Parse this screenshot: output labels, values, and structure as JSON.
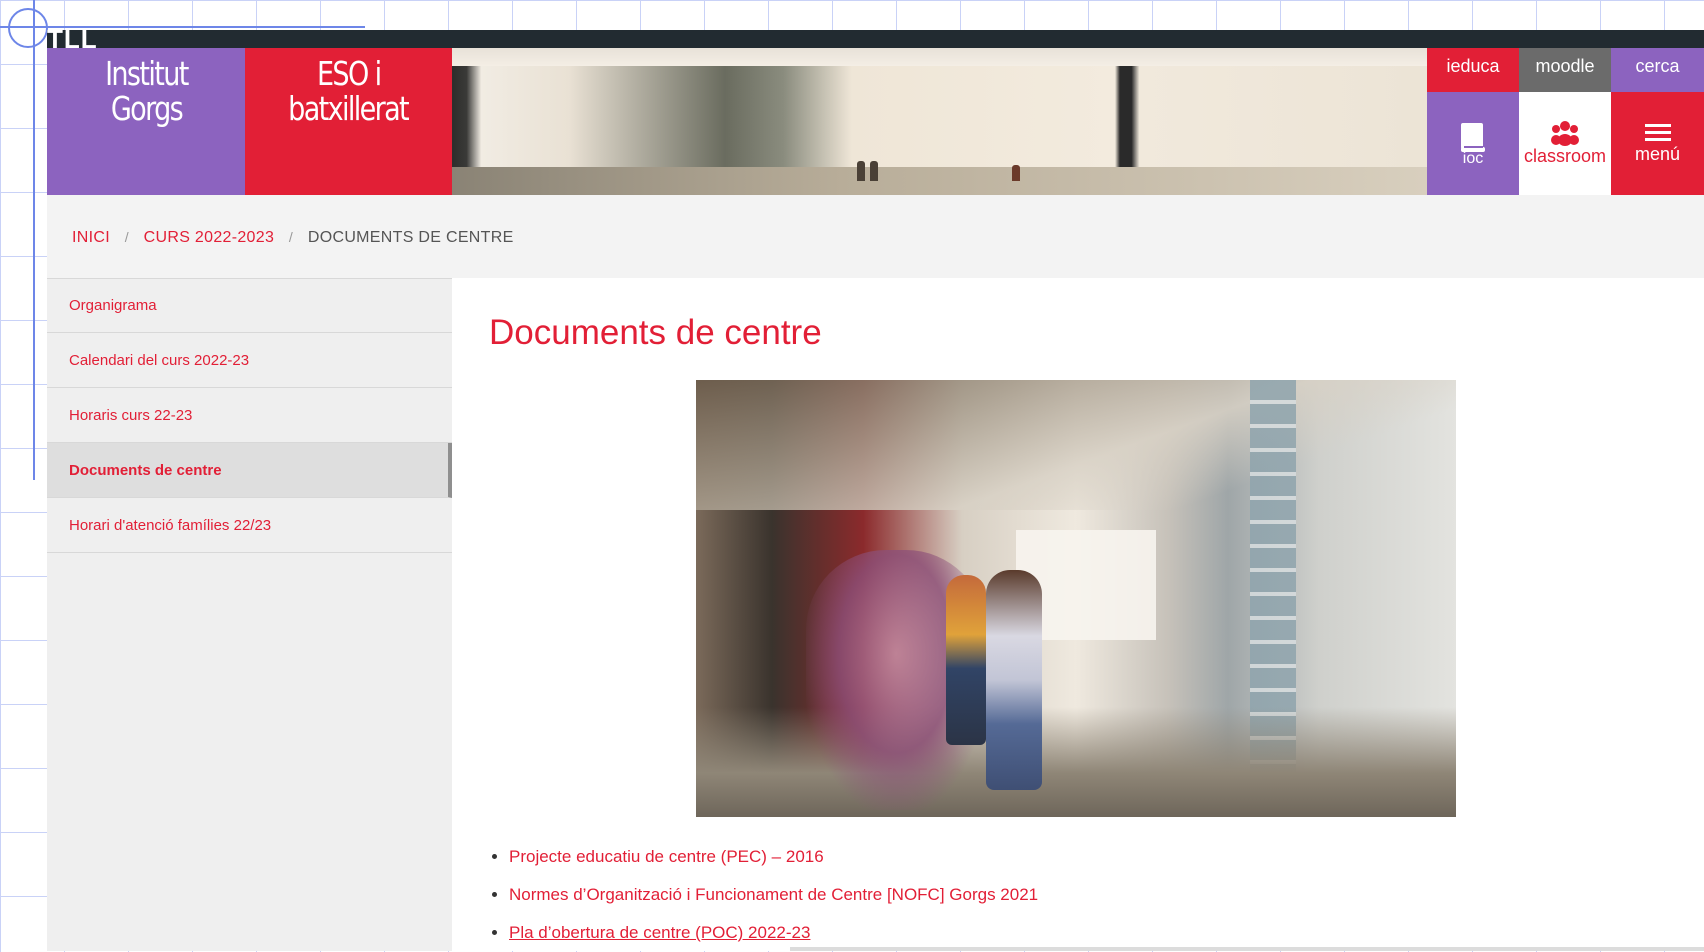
{
  "colors": {
    "brand_red": "#e21f36",
    "brand_purple": "#8c63bf",
    "moodle_gray": "#6b6b6b"
  },
  "topbar": {
    "partial_text": "TLL"
  },
  "logo": {
    "line1": "Institut",
    "line2": "Gorgs"
  },
  "level": {
    "line1": "ESO i",
    "line2": "batxillerat"
  },
  "quick_links": {
    "ieduca": "ieduca",
    "moodle": "moodle",
    "cerca": "cerca",
    "ioc": "ioc",
    "ioc_icon": "book-icon",
    "classroom": "classroom",
    "classroom_icon": "group-icon",
    "menu": "menú",
    "menu_icon": "hamburger-icon"
  },
  "breadcrumb": {
    "home": "INICI",
    "year": "CURS 2022-2023",
    "current": "DOCUMENTS DE CENTRE"
  },
  "sidebar": {
    "items": [
      {
        "label": "Organigrama",
        "active": false
      },
      {
        "label": "Calendari del curs 2022-23",
        "active": false
      },
      {
        "label": "Horaris curs 22-23",
        "active": false
      },
      {
        "label": "Documents de centre",
        "active": true
      },
      {
        "label": "Horari d'atenció famílies 22/23",
        "active": false
      }
    ]
  },
  "main": {
    "title": "Documents de centre",
    "documents": [
      "Projecte educatiu de centre (PEC) – 2016",
      "Normes d’Organització i Funcionament de Centre [NOFC] Gorgs 2021",
      "Pla d’obertura de centre (POC) 2022-23"
    ]
  }
}
